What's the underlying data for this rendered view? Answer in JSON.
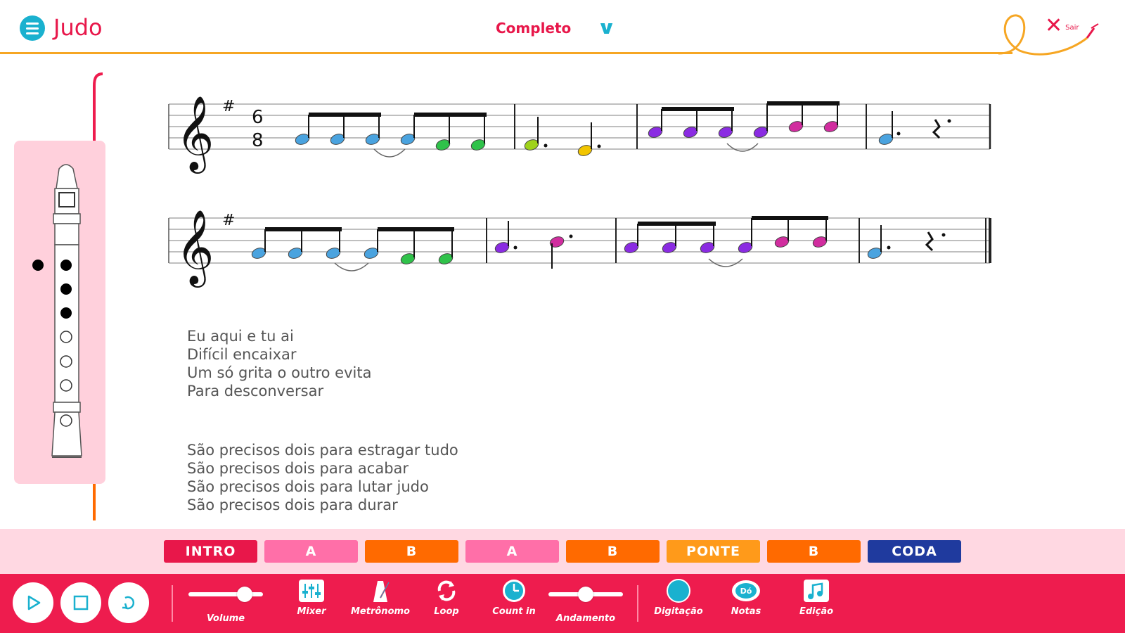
{
  "header": {
    "title": "Judo",
    "view_selected": "Completo",
    "exit_label": "Sair"
  },
  "lyrics": {
    "verse1": [
      "Eu aqui e tu ai",
      "Difícil encaixar",
      "Um só grita o outro evita",
      "Para desconversar"
    ],
    "verse2": [
      "São precisos dois para estragar tudo",
      "São precisos dois para acabar",
      "São precisos dois para lutar judo",
      "São precisos dois para durar"
    ]
  },
  "sections": [
    {
      "label": "INTRO",
      "color": "#e8174a"
    },
    {
      "label": "A",
      "color": "#ff6fa8"
    },
    {
      "label": "B",
      "color": "#ff6a00"
    },
    {
      "label": "A",
      "color": "#ff6fa8"
    },
    {
      "label": "B",
      "color": "#ff6a00"
    },
    {
      "label": "PONTE",
      "color": "#ff9a1a"
    },
    {
      "label": "B",
      "color": "#ff6a00"
    },
    {
      "label": "CODA",
      "color": "#1f3a9e"
    }
  ],
  "toolbar": {
    "volume_label": "Volume",
    "volume_level": 0.75,
    "mixer_label": "Mixer",
    "metronome_label": "Metrônomo",
    "loop_label": "Loop",
    "countin_label": "Count in",
    "tempo_label": "Andamento",
    "tempo_level": 0.5,
    "fingering_label": "Digitação",
    "notes_label": "Notas",
    "notes_icon_text": "Dó",
    "edit_label": "Edição"
  },
  "score": {
    "time_signature_top": "6",
    "time_signature_bottom": "8",
    "key_signature": "#"
  },
  "colors": {
    "accent": "#e8174a",
    "orange_line": "#f6a623",
    "cyan": "#1ab1cf",
    "note_blue": "#4aa3df",
    "note_green": "#2fc24a",
    "note_purple": "#8a2be2",
    "note_magenta": "#d12d9f",
    "note_yellow": "#f2c500",
    "note_lime": "#9fd21b"
  }
}
